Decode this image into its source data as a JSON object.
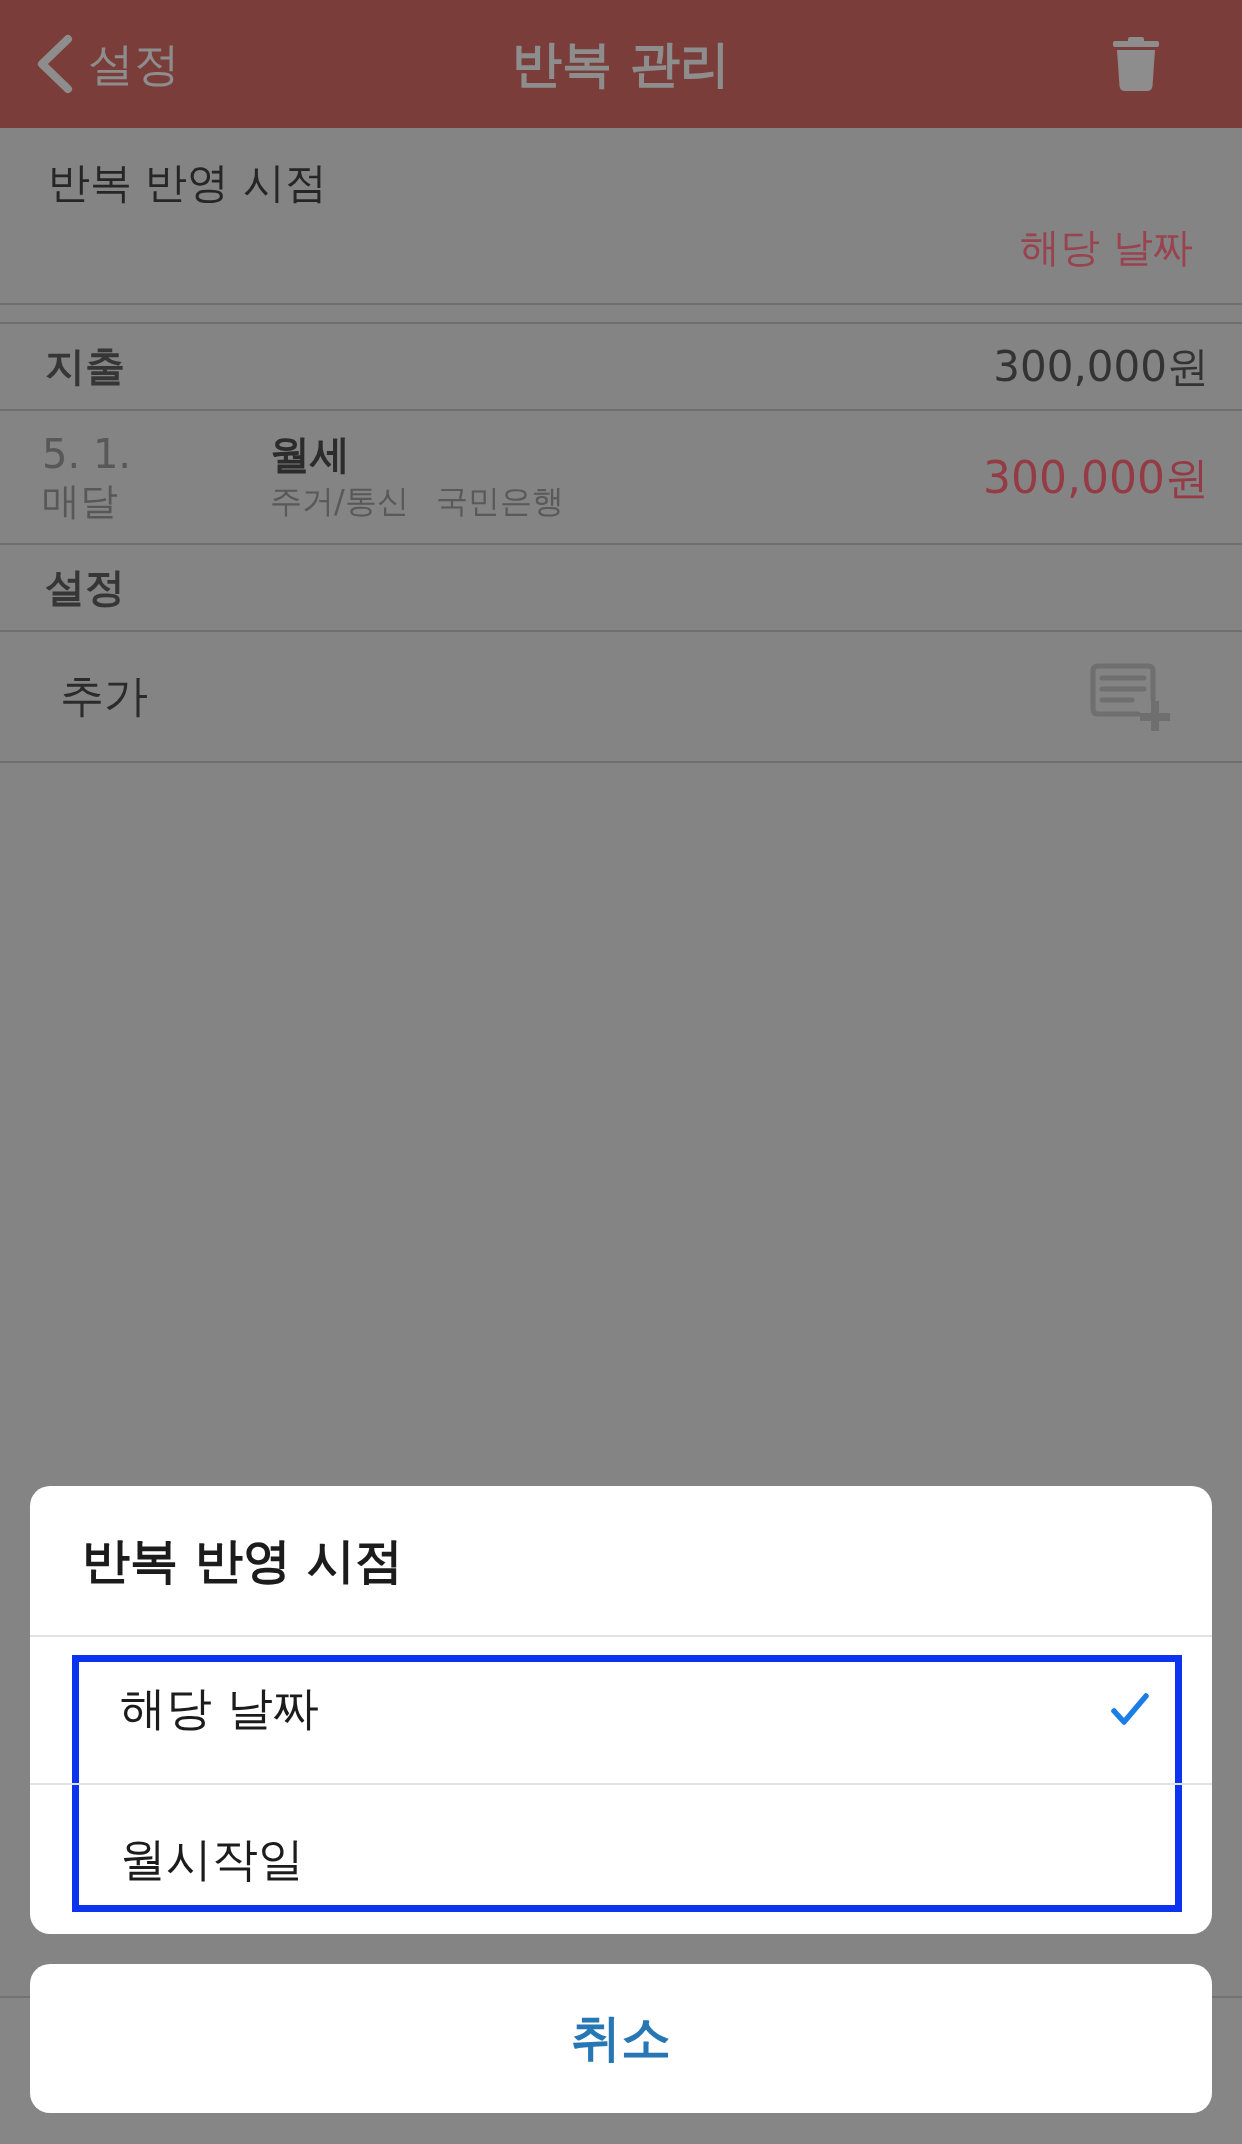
{
  "nav_bar": {
    "back_label": "설정",
    "title": "반복 관리"
  },
  "reflect_timing": {
    "label": "반복 반영 시점",
    "value": "해당 날짜"
  },
  "sections": [
    {
      "kind": "transactions",
      "header": "지출",
      "total": "300,000원",
      "rows": [
        {
          "date": "5. 1.",
          "frequency": "매달",
          "name": "월세",
          "category": "주거/통신",
          "account": "국민은행",
          "amount": "300,000원"
        }
      ]
    },
    {
      "kind": "actions",
      "header": "설정",
      "rows": [
        {
          "label": "추가"
        }
      ]
    }
  ],
  "action_sheet": {
    "title": "반복 반영 시점",
    "options_highlighted": true,
    "options": [
      {
        "label": "해당 날짜",
        "selected": true
      },
      {
        "label": "월시작일",
        "selected": false
      }
    ],
    "cancel": "취소"
  }
}
